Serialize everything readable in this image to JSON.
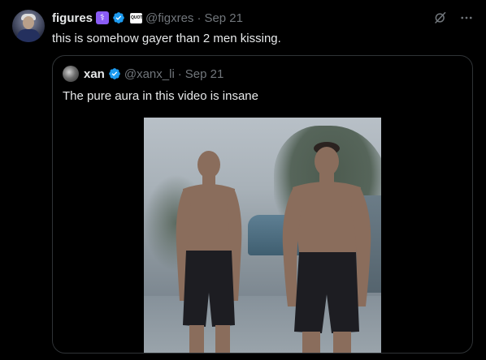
{
  "tweet": {
    "author_name": "figures",
    "emoji_badge": "⚕",
    "affiliation_badge": "QUOTE",
    "handle": "@figxres",
    "separator": "·",
    "date": "Sep 21",
    "text": "this is somehow gayer than 2 men kissing."
  },
  "quote": {
    "author_name": "xan",
    "handle": "@xanx_li",
    "separator": "·",
    "date": "Sep 21",
    "text": "The pure aura in this video is insane"
  },
  "icons": {
    "grok": "grok-icon",
    "more": "more-icon",
    "verified": "verified-badge-icon"
  },
  "colors": {
    "background": "#000000",
    "text_primary": "#e7e9ea",
    "text_secondary": "#71767b",
    "border": "#2f3336",
    "verified_blue": "#1d9bf0"
  }
}
